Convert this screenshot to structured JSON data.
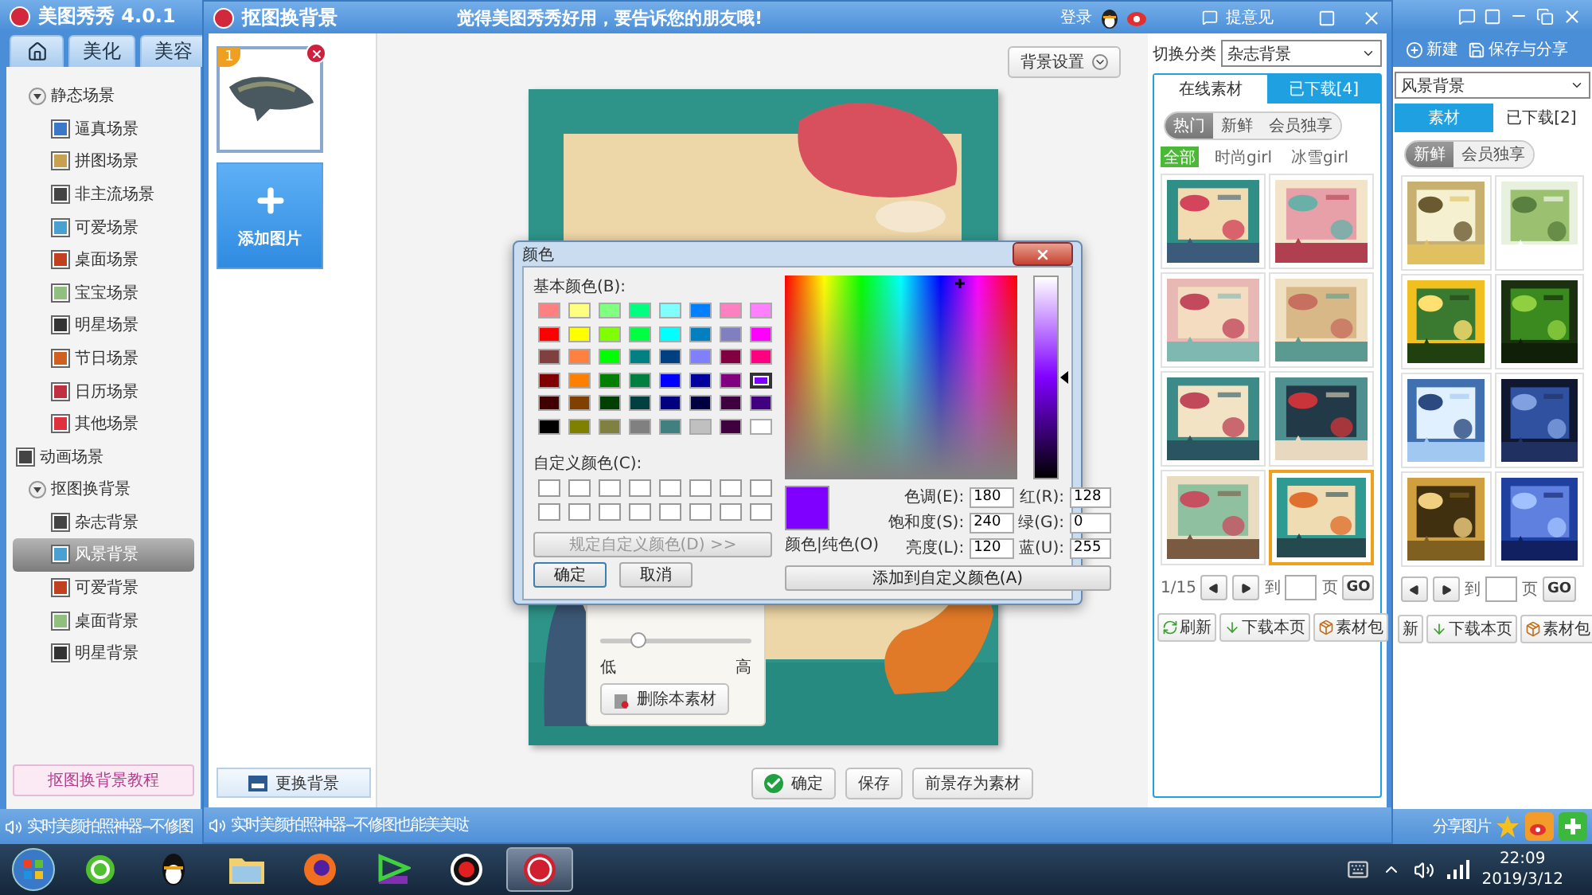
{
  "main_window": {
    "title": "美图秀秀 4.0.1",
    "nav_tabs": [
      {
        "kind": "home",
        "selected": false
      },
      {
        "kind": "text",
        "label": "美化",
        "selected": false
      },
      {
        "kind": "text",
        "label": "美容",
        "selected": false
      }
    ],
    "tree": [
      {
        "label": "静态场景",
        "expanded": true,
        "children": [
          {
            "label": "逼真场景",
            "selected": false
          },
          {
            "label": "拼图场景",
            "selected": false
          },
          {
            "label": "非主流场景",
            "selected": false
          },
          {
            "label": "可爱场景",
            "selected": false
          },
          {
            "label": "桌面场景",
            "selected": false
          },
          {
            "label": "宝宝场景",
            "selected": false
          },
          {
            "label": "明星场景",
            "selected": false
          },
          {
            "label": "节日场景",
            "selected": false
          },
          {
            "label": "日历场景",
            "selected": false
          },
          {
            "label": "其他场景",
            "selected": false
          }
        ]
      },
      {
        "label": "动画场景"
      },
      {
        "label": "抠图换背景",
        "expanded": true,
        "children": [
          {
            "label": "杂志背景",
            "selected": false
          },
          {
            "label": "风景背景",
            "selected": true
          },
          {
            "label": "可爱背景",
            "selected": false
          },
          {
            "label": "桌面背景",
            "selected": false
          },
          {
            "label": "明星背景",
            "selected": false
          }
        ]
      }
    ],
    "tutorial_button": "抠图换背景教程",
    "status_text": "实时美颜拍照神器--不修图",
    "toolbar": [
      "新建",
      "保存与分享"
    ],
    "category": "风景背景",
    "tabs": [
      {
        "label": "素材",
        "selected": false
      },
      {
        "label": "已下载[2]",
        "selected": true
      }
    ],
    "filters": [
      {
        "label": "新鲜",
        "selected": true
      },
      {
        "label": "会员独享",
        "selected": false
      }
    ],
    "thumbnails": [
      {
        "kind": "picture",
        "selected": false
      },
      {
        "kind": "picture",
        "selected": false
      },
      {
        "kind": "picture",
        "selected": false
      },
      {
        "kind": "picture",
        "selected": false
      },
      {
        "kind": "picture",
        "selected": false
      },
      {
        "kind": "picture",
        "selected": false
      },
      {
        "kind": "picture",
        "selected": false
      },
      {
        "kind": "picture",
        "selected": false
      }
    ],
    "pager": {
      "goto_label": "到",
      "page_label": "页",
      "go": "GO"
    },
    "actions": [
      {
        "kind": "plain",
        "label": "新"
      },
      {
        "kind": "download",
        "label": "下载本页"
      },
      {
        "kind": "package",
        "label": "素材包"
      }
    ],
    "share_label": "分享图片"
  },
  "cutout_dialog": {
    "title": "抠图换背景",
    "slogan": "觉得美图秀秀好用，要告诉您的朋友哦!",
    "login": "登录",
    "feedback": "提意见",
    "images": [
      {
        "badge": "1"
      }
    ],
    "add_image": "添加图片",
    "change_background": "更换背景",
    "background_settings": "背景设置",
    "opacity_panel": {
      "level": 0.25,
      "low": "低",
      "high": "高",
      "delete": "删除本素材"
    },
    "actions": [
      {
        "kind": "confirm",
        "label": "确定"
      },
      {
        "kind": "plain",
        "label": "保存"
      },
      {
        "kind": "plain",
        "label": "前景存为素材"
      }
    ],
    "material_panel": {
      "category_label": "切换分类",
      "category": "杂志背景",
      "tabs": [
        {
          "label": "在线素材",
          "selected": true
        },
        {
          "label": "已下载[4]",
          "selected": false
        }
      ],
      "filters": [
        {
          "label": "热门",
          "selected": true
        },
        {
          "label": "新鲜",
          "selected": false
        },
        {
          "label": "会员独享",
          "selected": false
        }
      ],
      "tags": [
        {
          "label": "全部",
          "selected": true
        },
        {
          "label": "时尚girl",
          "selected": false
        },
        {
          "label": "冰雪girl",
          "selected": false
        }
      ],
      "thumbnails": [
        {
          "kind": "picture",
          "selected": false
        },
        {
          "kind": "picture",
          "selected": false
        },
        {
          "kind": "picture",
          "selected": false
        },
        {
          "kind": "picture",
          "selected": false
        },
        {
          "kind": "picture",
          "selected": false
        },
        {
          "kind": "picture",
          "selected": false
        },
        {
          "kind": "picture",
          "selected": false
        },
        {
          "kind": "picture",
          "selected": true
        }
      ],
      "pager": {
        "page": "1/15",
        "goto_label": "到",
        "page_label": "页",
        "go": "GO"
      },
      "actions": [
        {
          "kind": "refresh",
          "label": "刷新"
        },
        {
          "kind": "download",
          "label": "下载本页"
        },
        {
          "kind": "package",
          "label": "素材包"
        }
      ]
    },
    "status_text": "实时美颜拍照神器--不修图也能美美哒"
  },
  "color_dialog": {
    "title": "颜色",
    "basic_label": "基本颜色(B):",
    "basic_colors": [
      {
        "color": "#ff8080",
        "selected": false
      },
      {
        "color": "#ffff80",
        "selected": false
      },
      {
        "color": "#80ff80",
        "selected": false
      },
      {
        "color": "#00ff80",
        "selected": false
      },
      {
        "color": "#80ffff",
        "selected": false
      },
      {
        "color": "#0080ff",
        "selected": false
      },
      {
        "color": "#ff80c0",
        "selected": false
      },
      {
        "color": "#ff80ff",
        "selected": false
      },
      {
        "color": "#ff0000",
        "selected": false
      },
      {
        "color": "#ffff00",
        "selected": false
      },
      {
        "color": "#80ff00",
        "selected": false
      },
      {
        "color": "#00ff40",
        "selected": false
      },
      {
        "color": "#00ffff",
        "selected": false
      },
      {
        "color": "#0080c0",
        "selected": false
      },
      {
        "color": "#8080c0",
        "selected": false
      },
      {
        "color": "#ff00ff",
        "selected": false
      },
      {
        "color": "#804040",
        "selected": false
      },
      {
        "color": "#ff8040",
        "selected": false
      },
      {
        "color": "#00ff00",
        "selected": false
      },
      {
        "color": "#008080",
        "selected": false
      },
      {
        "color": "#004080",
        "selected": false
      },
      {
        "color": "#8080ff",
        "selected": false
      },
      {
        "color": "#800040",
        "selected": false
      },
      {
        "color": "#ff0080",
        "selected": false
      },
      {
        "color": "#800000",
        "selected": false
      },
      {
        "color": "#ff8000",
        "selected": false
      },
      {
        "color": "#008000",
        "selected": false
      },
      {
        "color": "#008040",
        "selected": false
      },
      {
        "color": "#0000ff",
        "selected": false
      },
      {
        "color": "#0000a0",
        "selected": false
      },
      {
        "color": "#800080",
        "selected": false
      },
      {
        "color": "#8000ff",
        "selected": true
      },
      {
        "color": "#400000",
        "selected": false
      },
      {
        "color": "#804000",
        "selected": false
      },
      {
        "color": "#004000",
        "selected": false
      },
      {
        "color": "#004040",
        "selected": false
      },
      {
        "color": "#000080",
        "selected": false
      },
      {
        "color": "#000040",
        "selected": false
      },
      {
        "color": "#400040",
        "selected": false
      },
      {
        "color": "#400080",
        "selected": false
      },
      {
        "color": "#000000",
        "selected": false
      },
      {
        "color": "#808000",
        "selected": false
      },
      {
        "color": "#808040",
        "selected": false
      },
      {
        "color": "#808080",
        "selected": false
      },
      {
        "color": "#408080",
        "selected": false
      },
      {
        "color": "#c0c0c0",
        "selected": false
      },
      {
        "color": "#400040",
        "selected": false
      },
      {
        "color": "#ffffff",
        "selected": false
      }
    ],
    "custom_label": "自定义颜色(C):",
    "define_custom": {
      "label": "规定自定义颜色(D) >>",
      "disabled": true
    },
    "ok": "确定",
    "cancel": "取消",
    "luminance": {
      "level": 0.5
    },
    "preview_label": "颜色|纯色(O)",
    "fields": [
      {
        "label": "色调(E):",
        "value": "180"
      },
      {
        "label": "红(R):",
        "value": "128"
      },
      {
        "label": "饱和度(S):",
        "value": "240"
      },
      {
        "label": "绿(G):",
        "value": "0"
      },
      {
        "label": "亮度(L):",
        "value": "120"
      },
      {
        "label": "蓝(U):",
        "value": "255"
      }
    ],
    "add_custom": "添加到自定义颜色(A)"
  },
  "taskbar": {
    "apps": [
      {
        "kind": "security",
        "selected": false
      },
      {
        "kind": "qq",
        "selected": false
      },
      {
        "kind": "explorer",
        "selected": false
      },
      {
        "kind": "firefox",
        "selected": false
      },
      {
        "kind": "player",
        "selected": false
      },
      {
        "kind": "recorder",
        "selected": false
      },
      {
        "kind": "meitu",
        "selected": true
      }
    ],
    "time": "22:09",
    "date": "2019/3/12"
  }
}
